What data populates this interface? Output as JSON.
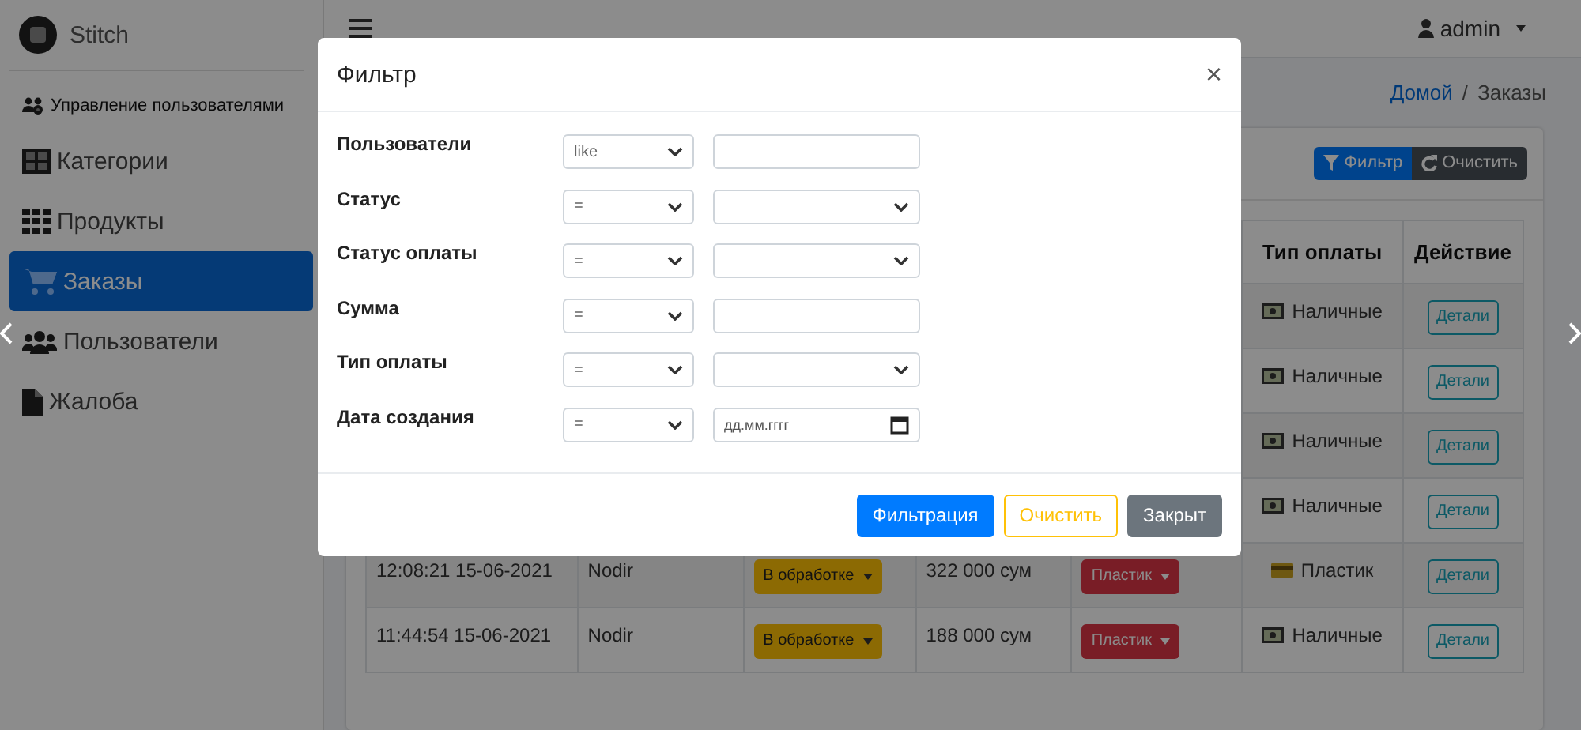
{
  "brand": {
    "title": "Stitch"
  },
  "sidebar": {
    "items": [
      {
        "label": "Управление пользователями",
        "selected": false
      },
      {
        "label": "Категории",
        "selected": false
      },
      {
        "label": "Продукты",
        "selected": false
      },
      {
        "label": "Заказы",
        "selected": true
      },
      {
        "label": "Пользователи",
        "selected": false
      },
      {
        "label": "Жалоба",
        "selected": false
      }
    ]
  },
  "topbar": {
    "user": "admin"
  },
  "breadcrumb": [
    {
      "label": "Домой",
      "kind": "link"
    },
    {
      "label": "/",
      "kind": "separator"
    },
    {
      "label": "Заказы",
      "kind": "text"
    }
  ],
  "toolbar": [
    {
      "label": "Фильтр",
      "kind": "primary"
    },
    {
      "label": "Очистить",
      "kind": "dark"
    }
  ],
  "table": {
    "columns": [
      null,
      null,
      null,
      null,
      null,
      {
        "label": "Тип оплаты"
      },
      {
        "label": "Действие"
      }
    ],
    "rows": [
      {
        "payment_type": "Наличные",
        "kind": "cash",
        "action": "Детали"
      },
      {
        "payment_type": "Наличные",
        "kind": "cash",
        "action": "Детали"
      },
      {
        "payment_type": "Наличные",
        "kind": "cash",
        "action": "Детали"
      },
      {
        "payment_type": "Наличные",
        "kind": "cash",
        "action": "Детали"
      },
      {
        "created": "12:08:21 15-06-2021",
        "user": "Nodir",
        "status": "В обработке",
        "amount": "322 000 сум",
        "payment_status": "Пластик",
        "payment_type": "Пластик",
        "kind": "card",
        "action": "Детали"
      },
      {
        "created": "11:44:54 15-06-2021",
        "user": "Nodir",
        "status": "В обработке",
        "amount": "188 000 сум",
        "payment_status": "Пластик",
        "payment_type": "Наличные",
        "kind": "cash",
        "action": "Детали"
      }
    ]
  },
  "modal": {
    "title": "Фильтр",
    "close": "×",
    "filters": [
      {
        "label": "Пользователи",
        "operator": "like",
        "kind": "text"
      },
      {
        "label": "Статус",
        "operator": "=",
        "kind": "select"
      },
      {
        "label": "Статус оплаты",
        "operator": "=",
        "kind": "select"
      },
      {
        "label": "Сумма",
        "operator": "=",
        "kind": "text"
      },
      {
        "label": "Тип оплаты",
        "operator": "=",
        "kind": "select"
      },
      {
        "label": "Дата создания",
        "operator": "=",
        "kind": "date",
        "placeholder": "дд.мм.гггг"
      }
    ],
    "buttons": [
      {
        "label": "Фильтрация",
        "kind": "primary"
      },
      {
        "label": "Очистить",
        "kind": "outline-warning"
      },
      {
        "label": "Закрыт",
        "kind": "secondary"
      }
    ]
  }
}
